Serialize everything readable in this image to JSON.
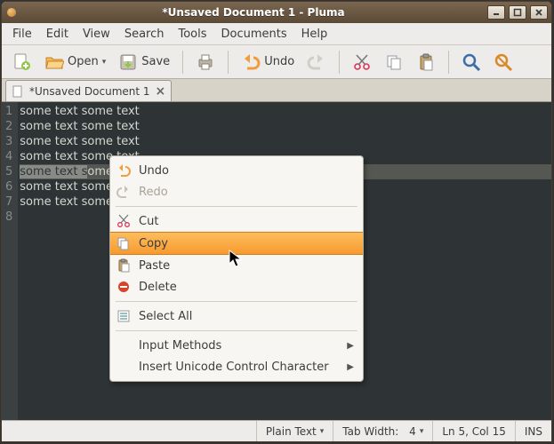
{
  "window": {
    "title": "*Unsaved Document 1 - Pluma"
  },
  "menubar": [
    "File",
    "Edit",
    "View",
    "Search",
    "Tools",
    "Documents",
    "Help"
  ],
  "toolbar": {
    "open": "Open",
    "save": "Save",
    "undo": "Undo"
  },
  "tabs": [
    {
      "label": "*Unsaved Document 1"
    }
  ],
  "editor": {
    "lines": [
      "some text some text",
      "some text some text",
      "some text some text",
      "some text some text",
      "some text some text",
      "some text some text",
      "some text some text",
      ""
    ],
    "selected_line_index": 4,
    "selected_prefix": "some text s",
    "selected_rest": "ome text"
  },
  "context_menu": {
    "undo": "Undo",
    "redo": "Redo",
    "cut": "Cut",
    "copy": "Copy",
    "paste": "Paste",
    "delete": "Delete",
    "select_all": "Select All",
    "input_methods": "Input Methods",
    "insert_ucc": "Insert Unicode Control Character"
  },
  "statusbar": {
    "plain_text": "Plain Text",
    "tab_width_label": "Tab Width:",
    "tab_width_value": "4",
    "position": "Ln 5, Col 15",
    "ins": "INS"
  }
}
